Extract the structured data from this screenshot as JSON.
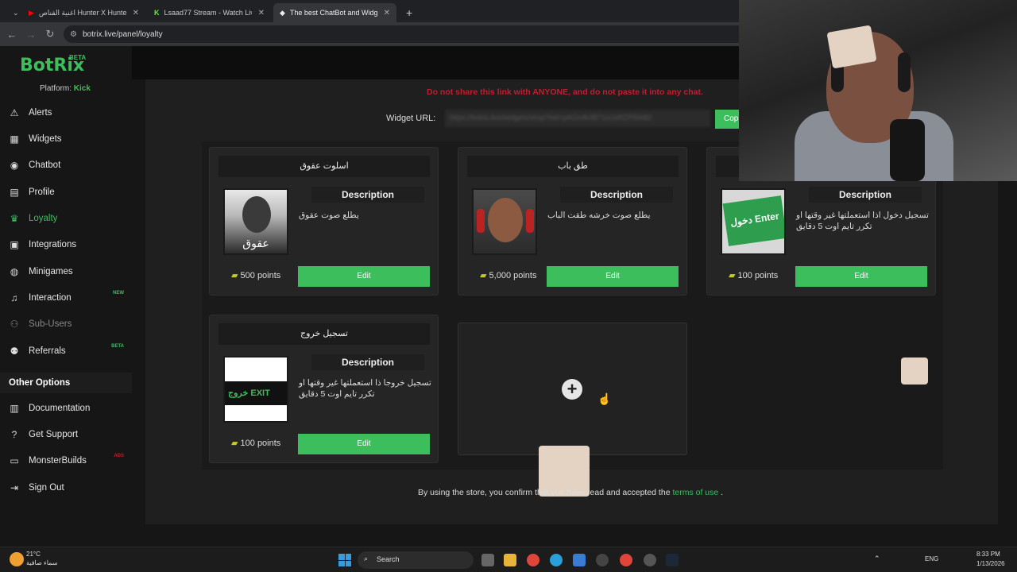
{
  "browser": {
    "tabs": [
      {
        "label": "اغنية القناص Hunter X Hunter ..."
      },
      {
        "label": "Lsaad77 Stream - Watch Live o..."
      },
      {
        "label": "The best ChatBot and Widgets ..."
      }
    ],
    "url": "botrix.live/panel/loyalty"
  },
  "sidebar": {
    "logo": "BotRix",
    "logo_badge": "BETA",
    "platform_label": "Platform:",
    "platform_value": "Kick",
    "items": [
      {
        "label": "Alerts",
        "icon": "warning-icon"
      },
      {
        "label": "Widgets",
        "icon": "grid-icon"
      },
      {
        "label": "Chatbot",
        "icon": "robot-icon"
      },
      {
        "label": "Profile",
        "icon": "id-card-icon"
      },
      {
        "label": "Loyalty",
        "icon": "trophy-icon"
      },
      {
        "label": "Integrations",
        "icon": "plug-icon"
      },
      {
        "label": "Minigames",
        "icon": "gamepad-icon"
      },
      {
        "label": "Interaction",
        "icon": "music-icon",
        "tag": "NEW"
      },
      {
        "label": "Sub-Users",
        "icon": "users-icon"
      },
      {
        "label": "Referrals",
        "icon": "people-icon",
        "tag": "BETA"
      }
    ],
    "other_options_label": "Other Options",
    "other_items": [
      {
        "label": "Documentation",
        "icon": "book-icon"
      },
      {
        "label": "Get Support",
        "icon": "question-icon"
      },
      {
        "label": "MonsterBuilds",
        "icon": "monitor-icon",
        "tag": "ADS"
      },
      {
        "label": "Sign Out",
        "icon": "sign-out-icon"
      }
    ]
  },
  "widget": {
    "warning": "Do not share this link with ANYONE, and do not paste it into any chat.",
    "label": "Widget URL:",
    "url_value": "https://botrix.live/widgets/shop?bid=pAGmfk3B71w1kRZPi5bt82",
    "copy_label": "Cop"
  },
  "cards": [
    {
      "title": "اسلوت عقوق",
      "description_heading": "Description",
      "description": "يطلع صوت عقوق",
      "points": "500 points",
      "edit_label": "Edit",
      "image_caption": "عقوق"
    },
    {
      "title": "طق باب",
      "description_heading": "Description",
      "description": "يطلع صوت خرشه طقت الباب",
      "points": "5,000 points",
      "edit_label": "Edit",
      "image_caption": ""
    },
    {
      "title": "",
      "description_heading": "Description",
      "description": "تسجيل دخول اذا استعملتها غير وقتها او تكرر تايم اوت 5 دقايق",
      "points": "100 points",
      "edit_label": "Edit",
      "image_caption": "دخول Enter"
    },
    {
      "title": "تسجيل خروج",
      "description_heading": "Description",
      "description": "تسجيل خروجا ذا استعملتها غير وقتها او تكرر تايم اوت 5 دقايق",
      "points": "100 points",
      "edit_label": "Edit",
      "image_caption": "خروج EXIT"
    }
  ],
  "footer": {
    "text_before": "By using the store, you confirm that you have read and accepted the",
    "link": "terms of use",
    "text_after": "."
  },
  "taskbar": {
    "temperature": "21°C",
    "weather": "سماء صافية",
    "search_label": "Search",
    "lang": "ENG",
    "time": "8:33 PM",
    "date": "1/13/2026"
  },
  "colors": {
    "accent": "#3dbe5c",
    "warning": "#c01f2f",
    "background": "#1f1f1f"
  }
}
